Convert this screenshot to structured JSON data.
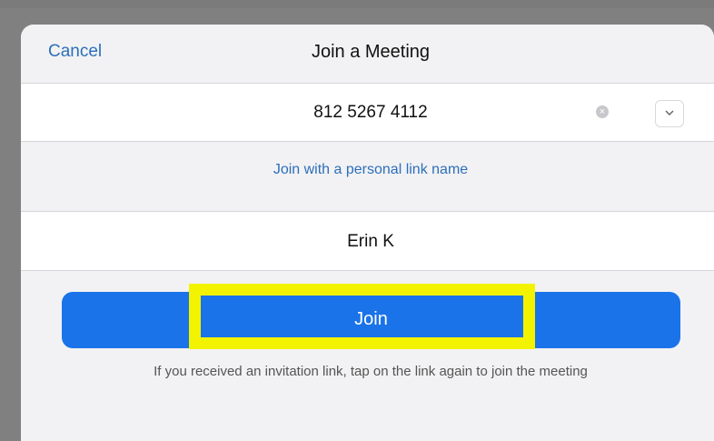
{
  "header": {
    "cancel_label": "Cancel",
    "title": "Join a Meeting"
  },
  "meeting_id": {
    "value": "812 5267 4112",
    "clear_icon": "clear-icon",
    "dropdown_icon": "chevron-down-icon"
  },
  "personal_link": {
    "label": "Join with a personal link name"
  },
  "display_name": {
    "value": "Erin K"
  },
  "join": {
    "label": "Join",
    "highlight_color": "#f3f300",
    "button_color": "#1a73e8"
  },
  "hint": {
    "text": "If you received an invitation link, tap on the link again to join the meeting"
  },
  "colors": {
    "link": "#2d6fb9",
    "backdrop": "#808080",
    "sheet": "#f2f2f4"
  }
}
